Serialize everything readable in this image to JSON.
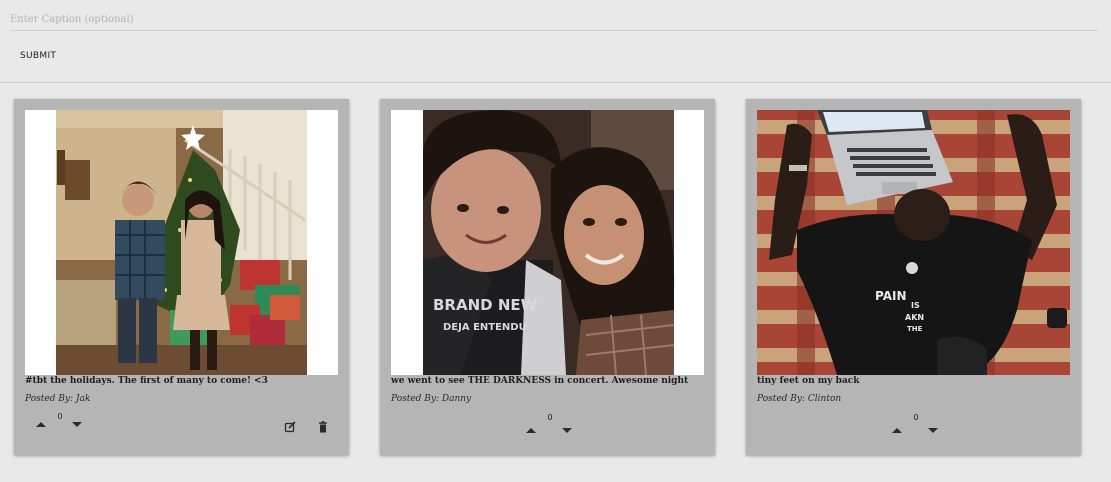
{
  "form": {
    "caption_placeholder": "Enter Caption (optional)",
    "caption_value": "",
    "submit_label": "SUBMIT"
  },
  "posts": [
    {
      "caption": "#tbt the holidays. The first of many to come! <3",
      "author": "Posted By: Jak",
      "votes": "0",
      "photo": "couple-by-christmas-tree",
      "actions": [
        "edit-icon",
        "trash-icon"
      ]
    },
    {
      "caption": "we went to see THE DARKNESS in concert. Awesome night",
      "author": "Posted By: Danny",
      "votes": "0",
      "photo": "couple-selfie"
    },
    {
      "caption": "tiny feet on my back",
      "author": "Posted By: Clinton",
      "votes": "0",
      "photo": "man-lying-on-rug-with-laptop"
    }
  ],
  "colors": {
    "page_background": "#e9e9e9",
    "card_background": "#b5b5b5"
  }
}
